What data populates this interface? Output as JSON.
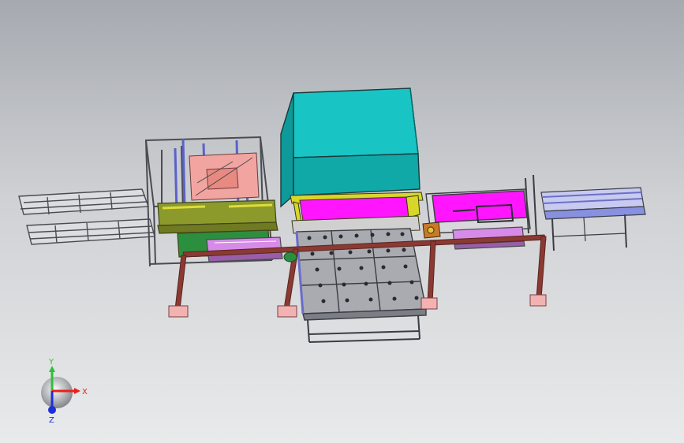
{
  "triad": {
    "x_label": "X",
    "y_label": "Y",
    "z_label": "Z",
    "x_color": "#e8201c",
    "y_color": "#2fbf3a",
    "z_color": "#1c2fd8"
  },
  "colors": {
    "background_top": "#a6aab0",
    "background_bottom": "#e9eaeb",
    "press_body": "#19c4c4",
    "magenta_panel": "#ff16ff",
    "yellow_trim": "#d9d62a",
    "table_grey": "#a9abb0",
    "frame_dark": "#4b4b52",
    "support_leg": "#8a3a32",
    "foot_pad": "#f3b2b2",
    "conveyor_blue": "#8890e0",
    "olive_base": "#8c9a2c",
    "green_motor": "#2c8f3f"
  }
}
